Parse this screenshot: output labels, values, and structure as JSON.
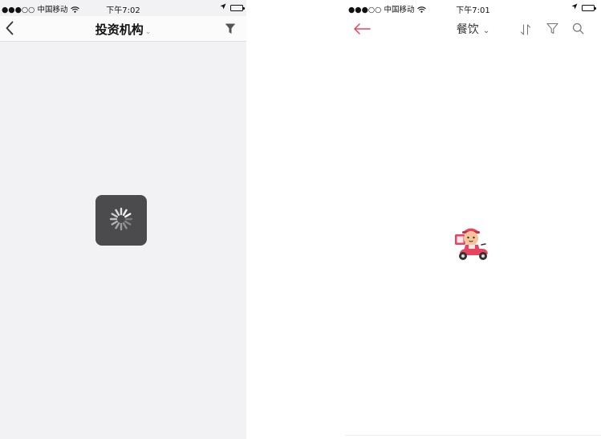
{
  "left_screen": {
    "status": {
      "carrier": "●●●○○ 中国移动",
      "time": "下午7:02"
    },
    "nav": {
      "title": "投资机构",
      "back_icon": "chevron-left-icon",
      "filter_icon": "filled-funnel-icon"
    },
    "loading": {
      "icon": "activity-spinner-icon",
      "color": "#4b4b4d"
    }
  },
  "right_screen": {
    "status": {
      "carrier": "●●●○○ 中国移动",
      "time": "下午7:01"
    },
    "nav": {
      "title": "餐饮",
      "back_icon": "arrow-left-icon",
      "sort_icon": "sort-arrows-icon",
      "filter_icon": "funnel-outline-icon",
      "search_icon": "search-icon"
    },
    "loading": {
      "icon": "delivery-scooter-mascot-icon"
    },
    "accent_color": "#e8435f"
  }
}
